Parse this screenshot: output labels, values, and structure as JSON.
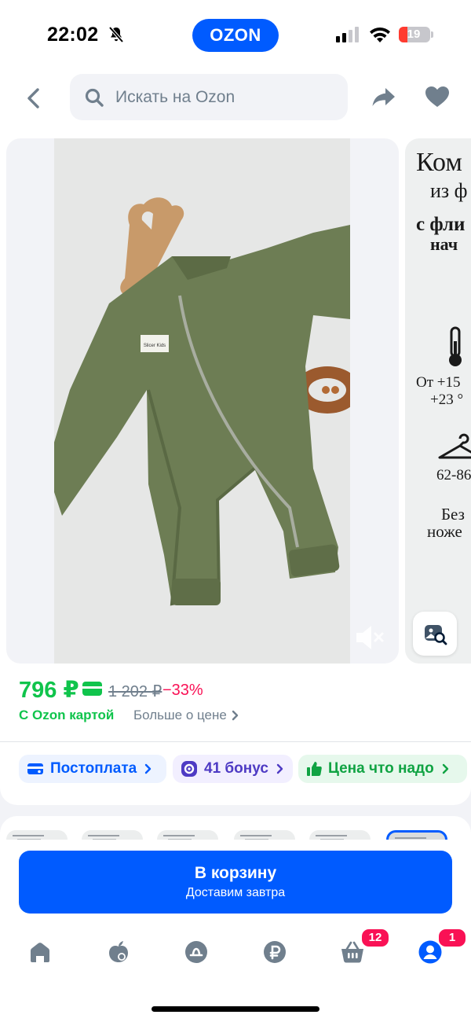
{
  "status_bar": {
    "time": "22:02",
    "battery": "19"
  },
  "brand": "OZON",
  "search": {
    "placeholder": "Искать на Ozon"
  },
  "gallery": {
    "slide2_lines": [
      "Ком",
      "из ф",
      "с фли",
      "нач",
      "От +15",
      "+23 °",
      "62-86",
      "Без",
      "ноже"
    ],
    "label_text": "Slicer Kids"
  },
  "price": {
    "current": "796 ₽",
    "old": "1 202 ₽",
    "discount": "−33%",
    "card_label": "С Ozon картой",
    "more_label": "Больше о цене"
  },
  "chips": [
    {
      "label": "Постоплата"
    },
    {
      "label": "41 бонус"
    },
    {
      "label": "Цена что надо"
    }
  ],
  "cart_button": {
    "label": "В корзину",
    "sublabel": "Доставим завтра"
  },
  "tabbar": {
    "cart_count": "12",
    "profile_count": "1"
  },
  "colors": {
    "brand_blue": "#005bff",
    "price_green": "#10c44c",
    "discount_pink": "#f91155",
    "bonus_purple": "#4e3bc4"
  }
}
